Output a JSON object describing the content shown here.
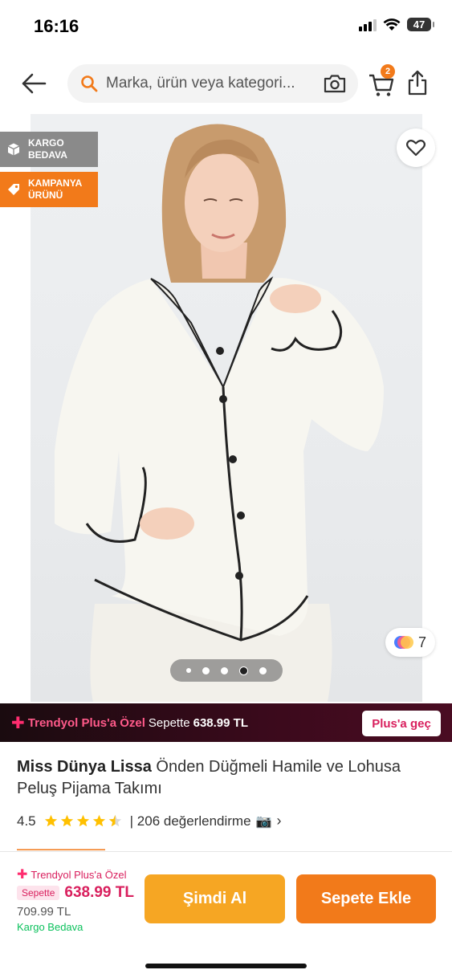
{
  "status_bar": {
    "time": "16:16",
    "battery": "47"
  },
  "header": {
    "search_placeholder": "Marka, ürün veya kategori...",
    "cart_count": "2"
  },
  "image_badges": {
    "kargo": "KARGO BEDAVA",
    "kampanya": "KAMPANYA ÜRÜNÜ"
  },
  "gallery": {
    "color_count": "7",
    "page_count": 5,
    "active_page": 4
  },
  "plus_banner": {
    "title": "Trendyol Plus'a Özel",
    "sub": "Sepette",
    "price": "638.99 TL",
    "button": "Plus'a geç"
  },
  "product": {
    "brand": "Miss Dünya Lissa",
    "name": "Önden Düğmeli Hamile ve Lohusa Peluş Pijama Takımı",
    "rating": "4.5",
    "rating_value": 4.5,
    "reviews": "| 206 değerlendirme",
    "camera": "📷",
    "chevron": "›"
  },
  "bottom_bar": {
    "plus_label": "Trendyol Plus'a Özel",
    "sepette_tag": "Sepette",
    "sepette_price": "638.99 TL",
    "old_price": "709.99 TL",
    "kargo": "Kargo Bedava",
    "buy_now": "Şimdi Al",
    "add_to_cart": "Sepete Ekle"
  },
  "colors": {
    "accent": "#f27a1a",
    "plus_pink": "#d9205e",
    "buy_now": "#f6a623",
    "green": "#0bc15c"
  }
}
